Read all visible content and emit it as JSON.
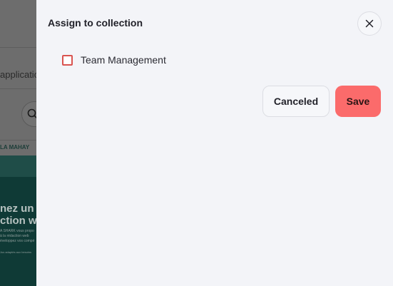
{
  "background": {
    "app_fragment": "applicatio",
    "brand_fragment": "LA MAHAY",
    "hero_heading_lines": [
      "nez un e",
      "ction we"
    ],
    "hero_small_lines": [
      "A SHARK vous propo",
      "à la rédaction web",
      "éveloppez vos compé"
    ],
    "hero_tiny": "Jus adaptés aux besoins"
  },
  "dialog": {
    "title": "Assign to collection",
    "close_icon": "close-icon",
    "options": [
      {
        "label": "Team Management",
        "checked": false
      }
    ],
    "cancel_label": "Canceled",
    "save_label": "Save",
    "colors": {
      "panel_bg": "#f3f4f8",
      "save_bg": "#fb6b6b",
      "checkbox_border": "#d9534f"
    }
  }
}
